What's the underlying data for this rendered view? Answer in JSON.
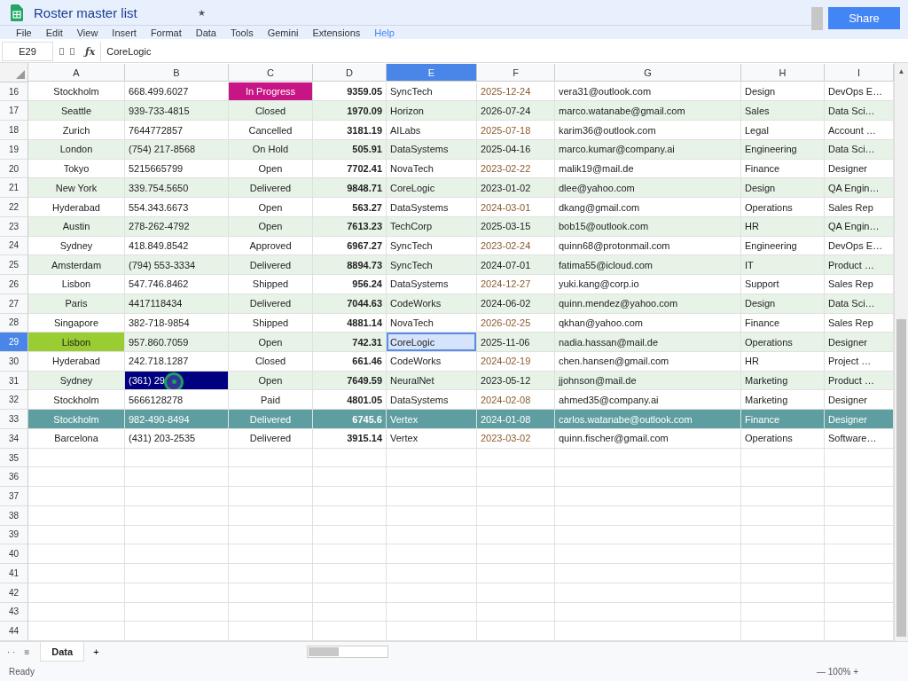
{
  "document": {
    "title": "Roster master list",
    "star": "★",
    "share": "Share"
  },
  "menu": [
    {
      "label": "File",
      "kind": "plain"
    },
    {
      "label": "Edit",
      "kind": "plain"
    },
    {
      "label": "View",
      "kind": "plain"
    },
    {
      "label": "Insert",
      "kind": "plain"
    },
    {
      "label": "Format",
      "kind": "plain"
    },
    {
      "label": "Data",
      "kind": "plain"
    },
    {
      "label": "Tools",
      "kind": "plain"
    },
    {
      "label": "Gemini",
      "kind": "plain"
    },
    {
      "label": "Extensions",
      "kind": "plain"
    },
    {
      "label": "Help",
      "kind": "link"
    }
  ],
  "formula_bar": {
    "cell_ref": "E29",
    "fx": "ƒx",
    "value": "CoreLogic"
  },
  "scroll_up": "▲",
  "columns": [
    {
      "label": "A",
      "selected": false
    },
    {
      "label": "B",
      "selected": false
    },
    {
      "label": "C",
      "selected": false
    },
    {
      "label": "D",
      "selected": false
    },
    {
      "label": "E",
      "selected": true
    },
    {
      "label": "F",
      "selected": false
    },
    {
      "label": "G",
      "selected": false
    },
    {
      "label": "H",
      "selected": false
    },
    {
      "label": "I",
      "selected": false
    }
  ],
  "rows": [
    {
      "n": "16",
      "selected": false,
      "highlighted": false,
      "cells": [
        "Stockholm",
        "668.499.6027",
        {
          "text": "In Progress",
          "color": "#c71585"
        },
        "9359.05",
        "SyncTech",
        "2025-12-24",
        "vera31@outlook.com",
        "Design",
        "DevOps E…"
      ]
    },
    {
      "n": "17",
      "selected": false,
      "highlighted": false,
      "cells": [
        "Seattle",
        "939-733-4815",
        "Closed",
        "1970.09",
        "Horizon",
        "2026-07-24",
        "marco.watanabe@gmail.com",
        "Sales",
        "Data Sci…"
      ]
    },
    {
      "n": "18",
      "selected": false,
      "highlighted": false,
      "cells": [
        "Zurich",
        "7644772857",
        "Cancelled",
        "3181.19",
        "AILabs",
        "2025-07-18",
        "karim36@outlook.com",
        "Legal",
        "Account …"
      ]
    },
    {
      "n": "19",
      "selected": false,
      "highlighted": false,
      "cells": [
        "London",
        "(754) 217-8568",
        "On Hold",
        "505.91",
        "DataSystems",
        "2025-04-16",
        "marco.kumar@company.ai",
        "Engineering",
        "Data Sci…"
      ]
    },
    {
      "n": "20",
      "selected": false,
      "highlighted": false,
      "cells": [
        "Tokyo",
        "5215665799",
        "Open",
        "7702.41",
        "NovaTech",
        "2023-02-22",
        "malik19@mail.de",
        "Finance",
        "Designer"
      ]
    },
    {
      "n": "21",
      "selected": false,
      "highlighted": false,
      "cells": [
        "New York",
        "339.754.5650",
        "Delivered",
        "9848.71",
        "CoreLogic",
        "2023-01-02",
        "dlee@yahoo.com",
        "Design",
        "QA Engin…"
      ]
    },
    {
      "n": "22",
      "selected": false,
      "highlighted": false,
      "cells": [
        "Hyderabad",
        "554.343.6673",
        "Open",
        "563.27",
        "DataSystems",
        "2024-03-01",
        "dkang@gmail.com",
        "Operations",
        "Sales Rep"
      ]
    },
    {
      "n": "23",
      "selected": false,
      "highlighted": false,
      "cells": [
        "Austin",
        "278-262-4792",
        "Open",
        "7613.23",
        "TechCorp",
        "2025-03-15",
        "bob15@outlook.com",
        "HR",
        "QA Engin…"
      ]
    },
    {
      "n": "24",
      "selected": false,
      "highlighted": false,
      "cells": [
        "Sydney",
        "418.849.8542",
        "Approved",
        "6967.27",
        "SyncTech",
        "2023-02-24",
        "quinn68@protonmail.com",
        "Engineering",
        "DevOps E…"
      ]
    },
    {
      "n": "25",
      "selected": false,
      "highlighted": false,
      "cells": [
        "Amsterdam",
        "(794) 553-3334",
        "Delivered",
        "8894.73",
        "SyncTech",
        "2024-07-01",
        "fatima55@icloud.com",
        "IT",
        "Product …"
      ]
    },
    {
      "n": "26",
      "selected": false,
      "highlighted": false,
      "cells": [
        "Lisbon",
        "547.746.8462",
        "Shipped",
        "956.24",
        "DataSystems",
        "2024-12-27",
        "yuki.kang@corp.io",
        "Support",
        "Sales Rep"
      ]
    },
    {
      "n": "27",
      "selected": false,
      "highlighted": false,
      "cells": [
        "Paris",
        "4417118434",
        "Delivered",
        "7044.63",
        "CodeWorks",
        "2024-06-02",
        "quinn.mendez@yahoo.com",
        "Design",
        "Data Sci…"
      ]
    },
    {
      "n": "28",
      "selected": false,
      "highlighted": false,
      "cells": [
        "Singapore",
        "382-718-9854",
        "Shipped",
        "4881.14",
        "NovaTech",
        "2026-02-25",
        "qkhan@yahoo.com",
        "Finance",
        "Sales Rep"
      ]
    },
    {
      "n": "29",
      "selected": true,
      "highlighted": false,
      "cells": [
        {
          "text": "Lisbon",
          "color": "#9acd32"
        },
        "957.860.7059",
        "Open",
        "742.31",
        "CoreLogic",
        "2025-11-06",
        "nadia.hassan@mail.de",
        "Operations",
        "Designer"
      ]
    },
    {
      "n": "30",
      "selected": false,
      "highlighted": false,
      "cells": [
        "Hyderabad",
        "242.718.1287",
        "Closed",
        "661.46",
        "CodeWorks",
        "2024-02-19",
        "chen.hansen@gmail.com",
        "HR",
        "Project …"
      ]
    },
    {
      "n": "31",
      "selected": false,
      "highlighted": false,
      "cells": [
        "Sydney",
        {
          "text": "(361) 29",
          "color": "#000080",
          "cursor": true
        },
        "Open",
        "7649.59",
        "NeuralNet",
        "2023-05-12",
        "jjohnson@mail.de",
        "Marketing",
        "Product …"
      ]
    },
    {
      "n": "32",
      "selected": false,
      "highlighted": false,
      "cells": [
        "Stockholm",
        "5666128278",
        "Paid",
        "4801.05",
        "DataSystems",
        "2024-02-08",
        "ahmed35@company.ai",
        "Marketing",
        "Designer"
      ]
    },
    {
      "n": "33",
      "selected": false,
      "highlighted": true,
      "cells": [
        "Stockholm",
        "982-490-8494",
        "Delivered",
        "6745.6",
        "Vertex",
        "2024-01-08",
        "carlos.watanabe@outlook.com",
        "Finance",
        "Designer"
      ]
    },
    {
      "n": "34",
      "selected": false,
      "highlighted": false,
      "cells": [
        "Barcelona",
        "(431) 203-2535",
        "Delivered",
        "3915.14",
        "Vertex",
        "2023-03-02",
        "quinn.fischer@gmail.com",
        "Operations",
        "Software…"
      ]
    },
    {
      "n": "35",
      "selected": false,
      "highlighted": false
    },
    {
      "n": "36",
      "selected": false,
      "highlighted": false
    },
    {
      "n": "37",
      "selected": false,
      "highlighted": false
    },
    {
      "n": "38",
      "selected": false,
      "highlighted": false
    },
    {
      "n": "39",
      "selected": false,
      "highlighted": false
    },
    {
      "n": "40",
      "selected": false,
      "highlighted": false
    },
    {
      "n": "41",
      "selected": false,
      "highlighted": false
    },
    {
      "n": "42",
      "selected": false,
      "highlighted": false
    },
    {
      "n": "43",
      "selected": false,
      "highlighted": false
    },
    {
      "n": "44",
      "selected": false,
      "highlighted": false
    }
  ],
  "sheet_bar": {
    "dots": "· ·",
    "list": "≡",
    "tabs": [
      {
        "label": "Data",
        "selected": true
      }
    ],
    "add": "+"
  },
  "status_bar": {
    "status": "Ready",
    "zoom": "— 100% +"
  }
}
